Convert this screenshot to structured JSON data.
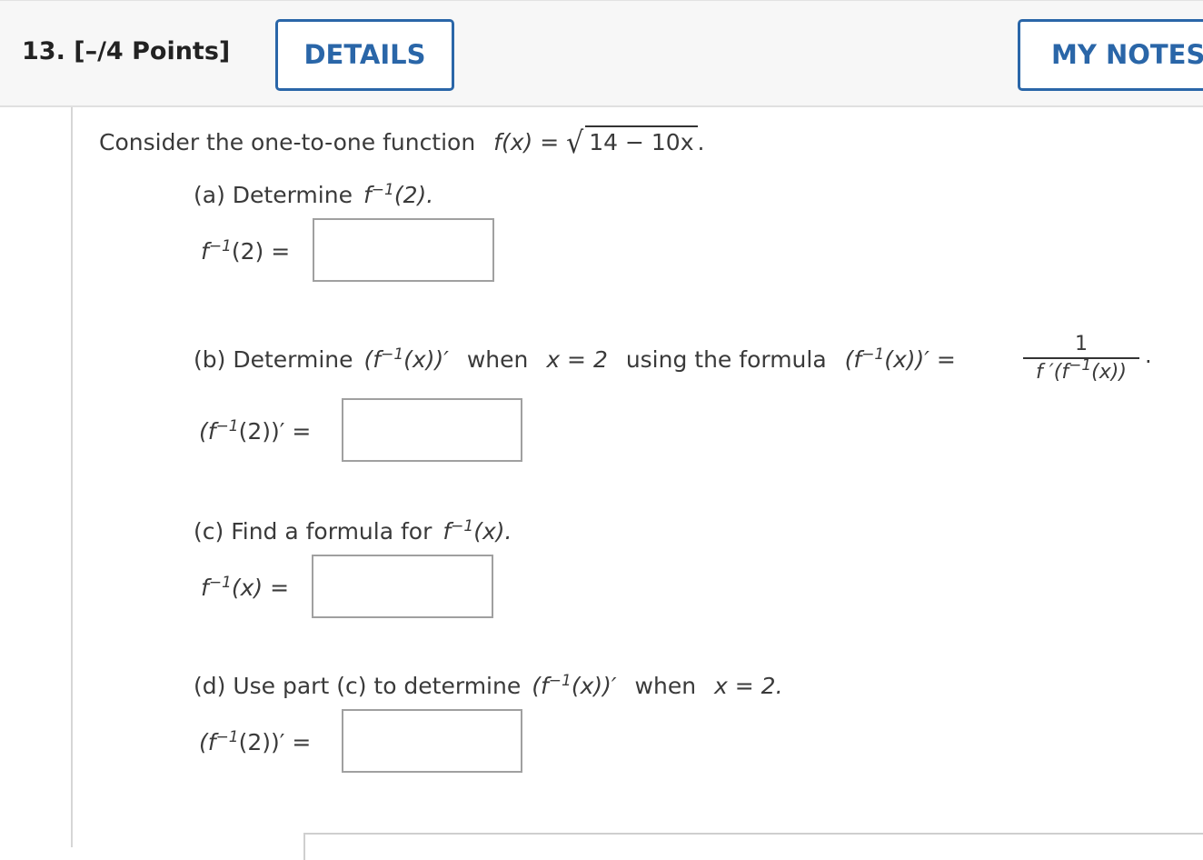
{
  "header": {
    "question_label": "13.  [–/4 Points]",
    "details_label": "DETAILS",
    "my_notes_label": "MY NOTES"
  },
  "problem": {
    "intro": "Consider the one-to-one function",
    "f_lhs": "f(x)",
    "eq": "=",
    "radicand": "14 − 10x",
    "period": "."
  },
  "part_a": {
    "prompt_prefix": "(a) Determine",
    "answer_label": "(2) =",
    "input_value": ""
  },
  "part_b": {
    "prompt_prefix": "(b) Determine",
    "when_text": "when",
    "x_eq": "x = 2",
    "formula_text": "using the formula",
    "fraction_numerator": "1",
    "answer_label": "(2))′ =",
    "input_value": ""
  },
  "part_c": {
    "prompt_prefix": "(c) Find a formula for",
    "answer_label": "(x) =",
    "input_value": ""
  },
  "part_d": {
    "prompt_prefix": "(d) Use part (c) to determine",
    "when_text": "when",
    "x_eq": "x = 2.",
    "answer_label": "(2))′ =",
    "input_value": ""
  },
  "colors": {
    "accent": "#2a66a8",
    "header_bg": "#f7f7f7",
    "input_border": "#a0a0a0"
  }
}
